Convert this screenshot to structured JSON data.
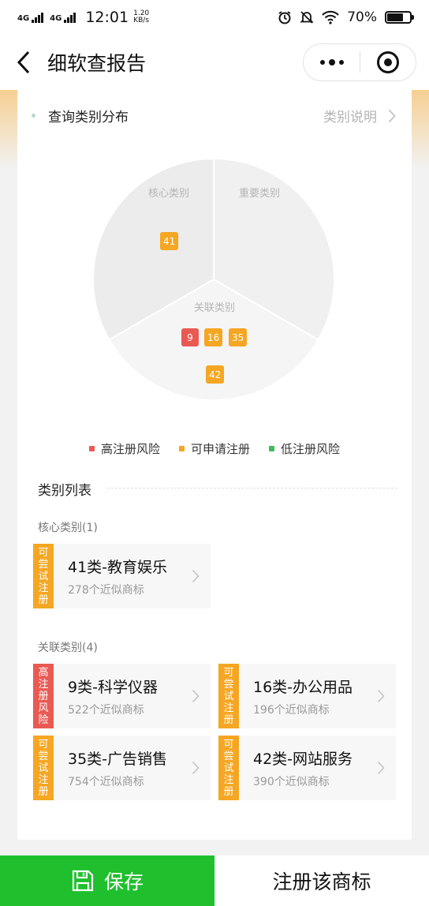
{
  "status_bar": {
    "network_1": "4G",
    "network_2": "4G",
    "time": "12:01",
    "speed_value": "1.20",
    "speed_unit": "KB/s",
    "battery": "70%",
    "icons": [
      "alarm-icon",
      "mute-icon",
      "wifi-icon",
      "battery-icon"
    ]
  },
  "nav": {
    "title": "细软查报告",
    "back_icon": "chevron-left-icon",
    "more_icon": "more-dots-icon",
    "close_icon": "target-close-icon"
  },
  "distribution": {
    "title": "查询类别分布",
    "explain_link": "类别说明",
    "pie": {
      "core_label": "核心类别",
      "important_label": "重要类别",
      "related_label": "关联类别",
      "core_chips": [
        "41"
      ],
      "related_chips_row1": [
        "9",
        "16",
        "35"
      ],
      "related_chips_row2": [
        "42"
      ]
    },
    "legend": [
      {
        "label": "高注册风险",
        "color": "#e95a53"
      },
      {
        "label": "可申请注册",
        "color": "#f5a623"
      },
      {
        "label": "低注册风险",
        "color": "#3dbb5b"
      }
    ]
  },
  "list": {
    "title": "类别列表",
    "core_group": "核心类别(1)",
    "related_group": "关联类别(4)",
    "core_items": [
      {
        "badge": "可尝试注册",
        "name": "41类-教育娱乐",
        "sub": "278个近似商标",
        "risk": "orange"
      }
    ],
    "related_items": [
      {
        "badge": "高注册风险",
        "name": "9类-科学仪器",
        "sub": "522个近似商标",
        "risk": "red"
      },
      {
        "badge": "可尝试注册",
        "name": "16类-办公用品",
        "sub": "196个近似商标",
        "risk": "orange"
      },
      {
        "badge": "可尝试注册",
        "name": "35类-广告销售",
        "sub": "754个近似商标",
        "risk": "orange"
      },
      {
        "badge": "可尝试注册",
        "name": "42类-网站服务",
        "sub": "390个近似商标",
        "risk": "orange"
      }
    ]
  },
  "bottom": {
    "save_label": "保存",
    "register_label": "注册该商标",
    "save_color": "#1fbf2d"
  }
}
